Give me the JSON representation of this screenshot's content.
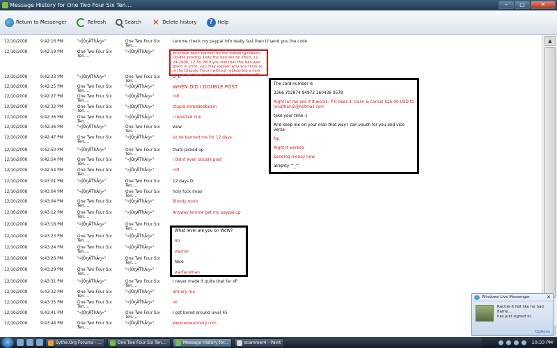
{
  "window": {
    "title": "Message History for One Two Four Six Ten....",
    "controls": {
      "minimize": "–",
      "maximize": "□",
      "close": "✕"
    }
  },
  "toolbar": {
    "return": "Return to Messenger",
    "refresh": "Refresh",
    "search": "Search",
    "delete": "Delete history",
    "help": "Help"
  },
  "messages": [
    {
      "date": "12/10/2008",
      "time": "9:42:16 PM",
      "from": "\"«ĴŐŋĂŤħĂŋ»\"",
      "to": "One Two Four Six Ten....",
      "text": "Lemme check my paypal info really fast then Ill send you the code",
      "red": false
    },
    {
      "date": "12/10/2008",
      "time": "9:42:19 PM",
      "from": "One Two Four Six Ten....",
      "to": "\"«ĴŐŋĂŤħĂŋ»\"",
      "text": "",
      "red": true
    },
    {
      "date": "12/10/2008",
      "time": "9:42:23 PM",
      "from": "\"«ĴŐŋĂŤħĂŋ»\"",
      "to": "One Two Four Six Ten....",
      "text": "O_o",
      "red": false
    },
    {
      "date": "12/10/2008",
      "time": "9:42:25 PM",
      "from": "One Two Four Six Ten....",
      "to": "\"«ĴŐŋĂŤħĂŋ»\"",
      "text": "WHEN DID I DOUBLE POST",
      "red": true,
      "big": true
    },
    {
      "date": "12/10/2008",
      "time": "9:42:27 PM",
      "from": "One Two Four Six Ten....",
      "to": "\"«ĴŐŋĂŤħĂŋ»\"",
      "text": "rofl",
      "red": true
    },
    {
      "date": "12/10/2008",
      "time": "9:42:32 PM",
      "from": "One Two Four Six Ten....",
      "to": "\"«ĴŐŋĂŤħĂŋ»\"",
      "text": "stupid shreddedbeam",
      "red": true
    },
    {
      "date": "12/10/2008",
      "time": "9:42:36 PM",
      "from": "One Two Four Six Ten....",
      "to": "\"«ĴŐŋĂŤħĂŋ»\"",
      "text": "i reported him",
      "red": true
    },
    {
      "date": "12/10/2008",
      "time": "9:42:36 PM",
      "from": "\"«ĴŐŋĂŤħĂŋ»\"",
      "to": "One Two Four Six Ten....",
      "text": "wow",
      "red": false
    },
    {
      "date": "12/10/2008",
      "time": "9:42:47 PM",
      "from": "One Two Four Six Ten....",
      "to": "\"«ĴŐŋĂŤħĂŋ»\"",
      "text": "so he banned me for 12 days",
      "red": true
    },
    {
      "date": "12/10/2008",
      "time": "9:42:50 PM",
      "from": "\"«ĴŐŋĂŤħĂŋ»\"",
      "to": "One Two Four Six Ten....",
      "text": "thats jacked up",
      "red": false
    },
    {
      "date": "12/10/2008",
      "time": "9:42:54 PM",
      "from": "One Two Four Six Ten....",
      "to": "\"«ĴŐŋĂŤħĂŋ»\"",
      "text": "i didnt even double post",
      "red": true
    },
    {
      "date": "12/10/2008",
      "time": "9:42:54 PM",
      "from": "One Two Four Six Ten....",
      "to": "\"«ĴŐŋĂŤħĂŋ»\"",
      "text": "rofl",
      "red": true
    },
    {
      "date": "12/10/2008",
      "time": "9:43:01 PM",
      "from": "\"«ĴŐŋĂŤħĂŋ»\"",
      "to": "One Two Four Six Ten....",
      "text": "12 days D:",
      "red": false
    },
    {
      "date": "12/10/2008",
      "time": "9:43:04 PM",
      "from": "\"«ĴŐŋĂŤħĂŋ»\"",
      "to": "One Two Four Six Ten....",
      "text": "holy fuck lmao",
      "red": false
    },
    {
      "date": "12/10/2008",
      "time": "9:43:04 PM",
      "from": "One Two Four Six Ten....",
      "to": "\"«ĴŐŋĂŤħĂŋ»\"",
      "text": "Bloody noob",
      "red": true
    },
    {
      "date": "12/10/2008",
      "time": "9:43:12 PM",
      "from": "One Two Four Six Ten....",
      "to": "\"«ĴŐŋĂŤħĂŋ»\"",
      "text": "Anyway lemme get my paypal up",
      "red": true
    },
    {
      "date": "12/10/2008",
      "time": "9:43:18 PM",
      "from": "\"«ĴŐŋĂŤħĂŋ»\"",
      "to": "One Two Four Six Ten....",
      "text": "",
      "red": false
    },
    {
      "date": "12/10/2008",
      "time": "9:43:23 PM",
      "from": "One Two Four Six Ten....",
      "to": "\"«ĴŐŋĂŤħĂŋ»\"",
      "text": "",
      "red": true
    },
    {
      "date": "12/10/2008",
      "time": "9:43:24 PM",
      "from": "One Two Four Six Ten....",
      "to": "\"«ĴŐŋĂŤħĂŋ»\"",
      "text": "",
      "red": true
    },
    {
      "date": "12/10/2008",
      "time": "9:43:26 PM",
      "from": "\"«ĴŐŋĂŤħĂŋ»\"",
      "to": "One Two Four Six Ten....",
      "text": "",
      "red": false
    },
    {
      "date": "12/10/2008",
      "time": "9:43:29 PM",
      "from": "One Two Four Six Ten....",
      "to": "\"«ĴŐŋĂŤħĂŋ»\"",
      "text": "",
      "red": true
    },
    {
      "date": "12/10/2008",
      "time": "9:43:31 PM",
      "from": "\"«ĴŐŋĂŤħĂŋ»\"",
      "to": "One Two Four Six Ten....",
      "text": "I never made it quite that far xP",
      "red": false
    },
    {
      "date": "12/10/2008",
      "time": "9:43:32 PM",
      "from": "One Two Four Six Ten....",
      "to": "\"«ĴŐŋĂŤħĂŋ»\"",
      "text": "armory me",
      "red": true
    },
    {
      "date": "12/10/2008",
      "time": "9:43:35 PM",
      "from": "One Two Four Six Ten....",
      "to": "\"«ĴŐŋĂŤħĂŋ»\"",
      "text": "lol",
      "red": true
    },
    {
      "date": "12/10/2008",
      "time": "9:43:41 PM",
      "from": "\"«ĴŐŋĂŤħĂŋ»\"",
      "to": "One Two Four Six Ten....",
      "text": "I got bored around level 45",
      "red": false
    },
    {
      "date": "12/10/2008",
      "time": "9:43:48 PM",
      "from": "One Two Four Six Ten....",
      "to": "\"«ĴŐŋĂŤħĂŋ»\"",
      "text": "www.wowarmory.com",
      "red": true
    }
  ],
  "ban_notice": "You have been banned for the following reason: Double posting. Date the ban will be lifted: 12-24-2008, 12:30 PM If you feel that this ban was given in error, you may explain why you think so in the Dispute Forum without registering a new account, and a moderator or administrator will review your case and come to a final decision.",
  "card_box": {
    "line1": "The card number is",
    "line2": "3266 702874 94972 160436 0578",
    "line3": "Aight let me see if it works. If it does ill claim & cancel $25.00 USD to Jonathanj2@hotmail.com",
    "line4": "take your time :)",
    "line5": "And keep me on your man that way I can vouch for you and vice versa",
    "line6": "Np",
    "line7": "Aight it worked",
    "line8": "Sending money now",
    "line9": "alrighty ^_^"
  },
  "wow_box": {
    "line1": "What level are you on WoW?",
    "line2": "80",
    "line3": "warrior",
    "line4": "Nice",
    "line5": "warfaceman"
  },
  "toast": {
    "title": "Windows Live Messenger",
    "close": "✕",
    "text1": "Rachie-It felt like he had flame...",
    "text2": "has just signed in.",
    "options": "Options"
  },
  "taskbar": {
    "tasks": [
      "Sythe.Org Forums - ...",
      "One Two Four Six Ten....",
      "Message History for...",
      "scammer4 - Paint"
    ],
    "clock": "10:33 PM"
  },
  "colors": {
    "red_text": "#cc1f1f",
    "ban_border": "#c81818"
  }
}
